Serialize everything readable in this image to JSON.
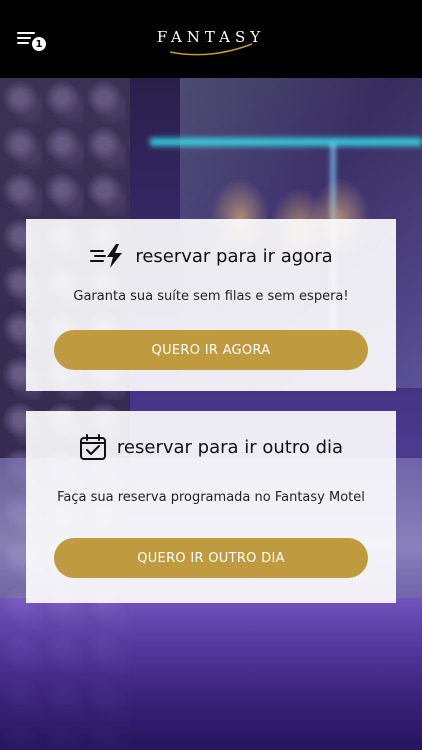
{
  "header": {
    "menu_badge": "1",
    "logo_text": "FANTASY"
  },
  "cards": [
    {
      "title": "reservar para ir agora",
      "subtitle": "Garanta sua suíte sem filas e sem espera!",
      "button_label": "QUERO IR AGORA",
      "icon": "fast-lightning-icon"
    },
    {
      "title": "reservar para ir outro dia",
      "subtitle": "Faça sua reserva programada no Fantasy Motel",
      "button_label": "QUERO IR OUTRO DIA",
      "icon": "calendar-check-icon"
    }
  ],
  "colors": {
    "header_bg": "#000000",
    "button_gold": "#bf9a3e",
    "card_bg": "#ffffff"
  }
}
